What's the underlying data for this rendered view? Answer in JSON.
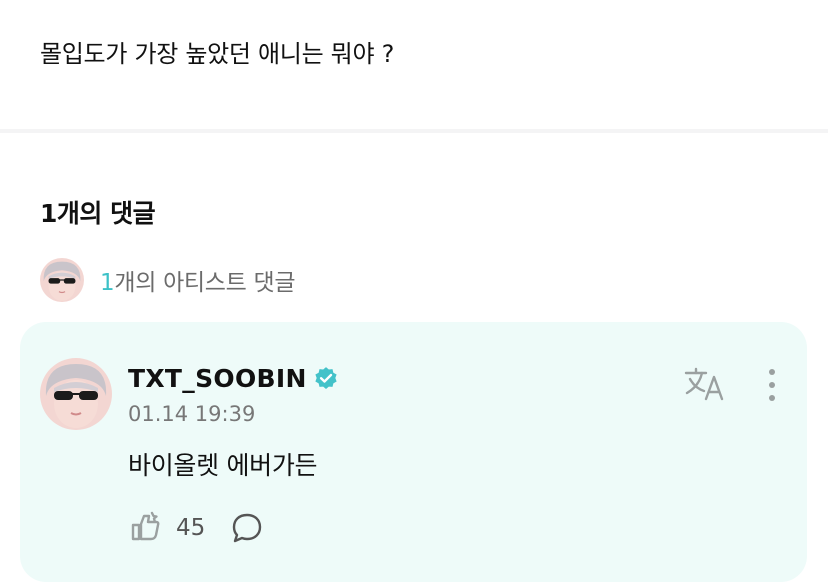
{
  "post": {
    "text": "몰입도가 가장 높았던 애니는 뭐야 ?"
  },
  "comments_section": {
    "title": "1개의 댓글",
    "artist_summary": {
      "count": "1",
      "suffix": "개의 아티스트 댓글"
    }
  },
  "comment": {
    "author": "TXT_SOOBIN",
    "timestamp": "01.14 19:39",
    "body": "바이올렛 에버가든",
    "likes": "45",
    "icons": {
      "verified": "verified-badge-icon",
      "translate": "translate-icon",
      "more": "more-vertical-icon",
      "like": "like-icon",
      "reply": "speech-bubble-icon"
    }
  },
  "colors": {
    "accent": "#3cc1c7",
    "card_background": "#eefbf9",
    "verified": "#43c2c9",
    "muted_text": "#777777",
    "icon": "#9aa0a0"
  }
}
